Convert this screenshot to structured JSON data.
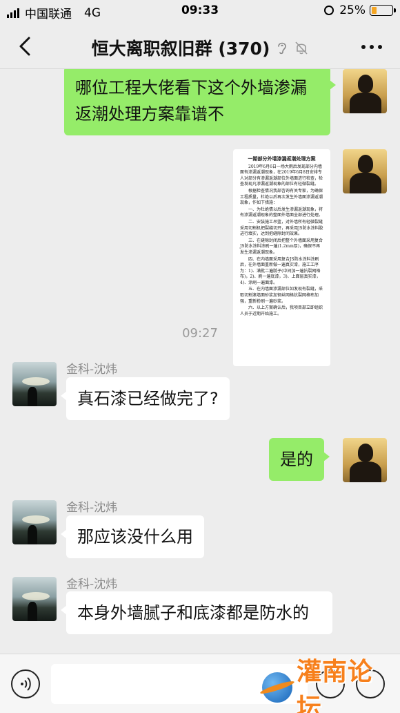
{
  "status_bar": {
    "carrier": "中国联通",
    "network": "4G",
    "time": "09:33",
    "battery_percent": "25%",
    "battery_level": 0.25
  },
  "nav": {
    "title": "恒大离职叙旧群 (370)"
  },
  "messages": [
    {
      "type": "self",
      "text": "哪位工程大佬看下这个外墙渗漏返潮处理方案靠谱不"
    },
    {
      "type": "self-image"
    },
    {
      "type": "timestamp",
      "text": "09:27"
    },
    {
      "type": "other",
      "sender": "金科-沈炜",
      "text": "真石漆已经做完了?"
    },
    {
      "type": "self",
      "text": "是的"
    },
    {
      "type": "other",
      "sender": "金科-沈炜",
      "text": "那应该没什么用"
    },
    {
      "type": "other",
      "sender": "金科-沈炜",
      "text": "本身外墙腻子和底漆都是防水的"
    }
  ],
  "document": {
    "title": "一期部分外墙渗漏返潮处理方案",
    "paragraphs": [
      "2019年6月6日一场大雨后发现部分内墙面有渗漏返潮现象，在2019年6月8日安排专人对部分有渗漏返潮部位外墙面进行检查，检查发现凡渗漏返潮现象的部位有轻微裂缝。",
      "根据检查情况我部咨询有关专家，为确保工程质量，杜绝以后再次发生外墙面渗漏返潮现象，作如下措施：",
      "一、为杜绝情以后发生渗漏返潮现象，将有渗漏返潮现象的整面外墙面全部进行处理。",
      "二、安装施工吊篮，对外墙所有轻微裂缝采用切割机把裂缝切开，再采用JS防水涂料胶进行填实，达到把缝隙封闭效果。",
      "三、在缝隙封闭后把整个外墙面采用复合JS防水涂料涂刷一遍(1.2mm厚)，确保不再发生渗漏返潮现象。",
      "四、在内墙面采用复合JS防水涂料涂刷后，在外墙面重新做一遍真实漆，施工工序为：1)、满批二遍腻子(中间加一遍抗裂网格布)，2)、刷一遍底漆，3)、上面层真实漆，4)、涂刷一遍面漆。",
      "五、在内墙面渗漏部位如发现有裂缝，采取切割滚墙面砂浆加钢丝网格抗裂网格布加强，重新粉刷一遍砂浆。",
      "六、以上方案确认后，我项目部立即组织人员于近期开始施工。"
    ]
  },
  "watermark": {
    "text": "灌南论坛"
  }
}
